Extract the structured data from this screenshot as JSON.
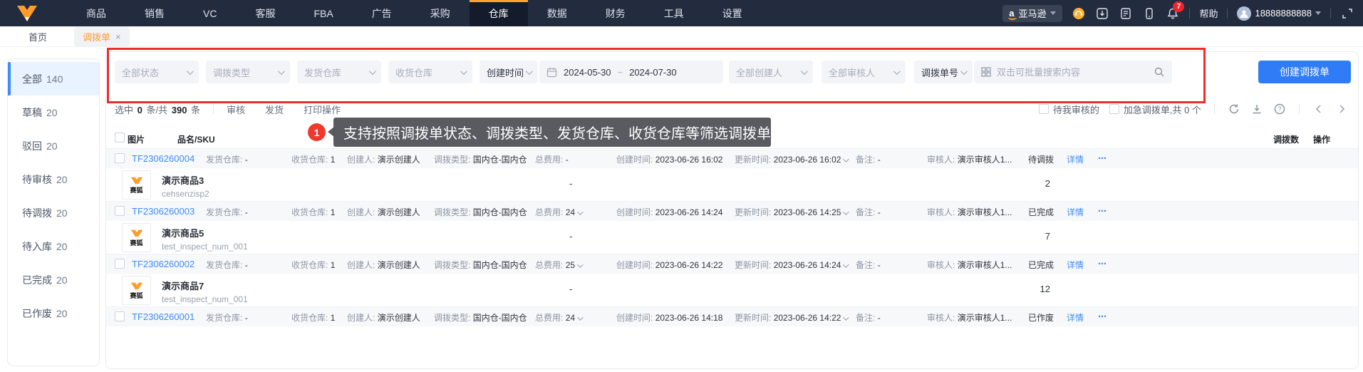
{
  "topnav": {
    "menu": [
      {
        "label": "商品"
      },
      {
        "label": "销售"
      },
      {
        "label": "VC"
      },
      {
        "label": "客服"
      },
      {
        "label": "FBA"
      },
      {
        "label": "广告"
      },
      {
        "label": "采购"
      },
      {
        "label": "仓库"
      },
      {
        "label": "数据"
      },
      {
        "label": "财务"
      },
      {
        "label": "工具"
      },
      {
        "label": "设置"
      }
    ],
    "active_menu": "仓库",
    "marketplace_label": "亚马逊",
    "marketplace_icon_letter": "a",
    "bell_badge": "7",
    "help_label": "帮助",
    "username": "18888888888"
  },
  "tabbar": {
    "tabs": [
      {
        "label": "首页"
      },
      {
        "label": "调拨单",
        "close": "×"
      }
    ]
  },
  "sidebar": {
    "items": [
      {
        "label": "全部",
        "count": "140"
      },
      {
        "label": "草稿",
        "count": "20"
      },
      {
        "label": "驳回",
        "count": "20"
      },
      {
        "label": "待审核",
        "count": "20"
      },
      {
        "label": "待调拨",
        "count": "20"
      },
      {
        "label": "待入库",
        "count": "20"
      },
      {
        "label": "已完成",
        "count": "20"
      },
      {
        "label": "已作废",
        "count": "20"
      }
    ]
  },
  "filters": {
    "status_placeholder": "全部状态",
    "type_placeholder": "调拨类型",
    "from_wh_placeholder": "发货仓库",
    "to_wh_placeholder": "收货仓库",
    "time_field_value": "创建时间",
    "date_start": "2024-05-30",
    "date_separator": "~",
    "date_end": "2024-07-30",
    "creator_placeholder": "全部创建人",
    "auditor_placeholder": "全部审核人",
    "search_field_value": "调拨单号",
    "search_placeholder": "双击可批量搜索内容",
    "create_button": "创建调拨单"
  },
  "toolbar": {
    "selected_prefix": "选中",
    "selected_count": "0",
    "selected_mid": "条/共",
    "total_count": "390",
    "selected_suffix": "条",
    "audit": "审核",
    "ship": "发货",
    "print": "打印操作",
    "my_audit": "待我审核的",
    "urgent": "加急调拨单,共 0 个"
  },
  "annotation": {
    "badge": "1",
    "text": "支持按照调拨单状态、调拨类型、发货仓库、收货仓库等筛选调拨单"
  },
  "table": {
    "header": {
      "image": "图片",
      "name_sku": "品名/SKU",
      "qty": "调拨数",
      "action": "操作"
    },
    "labels": {
      "from": "发货仓库:",
      "to": "收货仓库:",
      "creator": "创建人:",
      "type": "调拨类型:",
      "cost": "总费用:",
      "created": "创建时间:",
      "updated": "更新时间:",
      "remark": "备注:",
      "auditor": "审核人:"
    },
    "detail_label": "详情",
    "more_label": "⋯",
    "brand_tag": "赛狐",
    "orders": [
      {
        "no": "TF2306260004",
        "from": "-",
        "to": "1",
        "creator": "演示创建人",
        "type": "国内仓-国内仓",
        "cost": "-",
        "created": "2023-06-26 16:02",
        "updated": "2023-06-26 16:02",
        "remark": "-",
        "auditor": "演示审核人1...",
        "status": "待调拨",
        "product": {
          "name": "演示商品3",
          "sku": "cehsenzisp2",
          "cost_dash": "-",
          "qty": "2"
        }
      },
      {
        "no": "TF2306260003",
        "from": "-",
        "to": "1",
        "creator": "演示创建人",
        "type": "国内仓-国内仓",
        "cost": "24",
        "created": "2023-06-26 14:24",
        "updated": "2023-06-26 14:25",
        "remark": "-",
        "auditor": "演示审核人1...",
        "status": "已完成",
        "product": {
          "name": "演示商品5",
          "sku": "test_inspect_num_001",
          "cost_dash": "-",
          "qty": "7"
        }
      },
      {
        "no": "TF2306260002",
        "from": "-",
        "to": "1",
        "creator": "演示创建人",
        "type": "国内仓-国内仓",
        "cost": "25",
        "created": "2023-06-26 14:22",
        "updated": "2023-06-26 14:24",
        "remark": "-",
        "auditor": "演示审核人1...",
        "status": "已完成",
        "product": {
          "name": "演示商品7",
          "sku": "test_inspect_num_001",
          "cost_dash": "-",
          "qty": "12"
        }
      },
      {
        "no": "TF2306260001",
        "from": "-",
        "to": "1",
        "creator": "演示创建人",
        "type": "国内仓-国内仓",
        "cost": "24",
        "created": "2023-06-26 14:18",
        "updated": "2023-06-26 14:22",
        "remark": "-",
        "auditor": "演示审核人1...",
        "status": "已作废"
      }
    ]
  },
  "colors": {
    "nav_bg": "#232b3f",
    "brand_orange": "#ffa22d",
    "accent_blue": "#2f7cf6",
    "link_blue": "#3d8bf8",
    "annotation_red": "#f12b2b",
    "badge_red": "#f5222d",
    "active_tab_orange": "#ff9a2e",
    "sidebar_active_bg": "#e9f2ff",
    "strip_bg": "#f7f8fa"
  }
}
